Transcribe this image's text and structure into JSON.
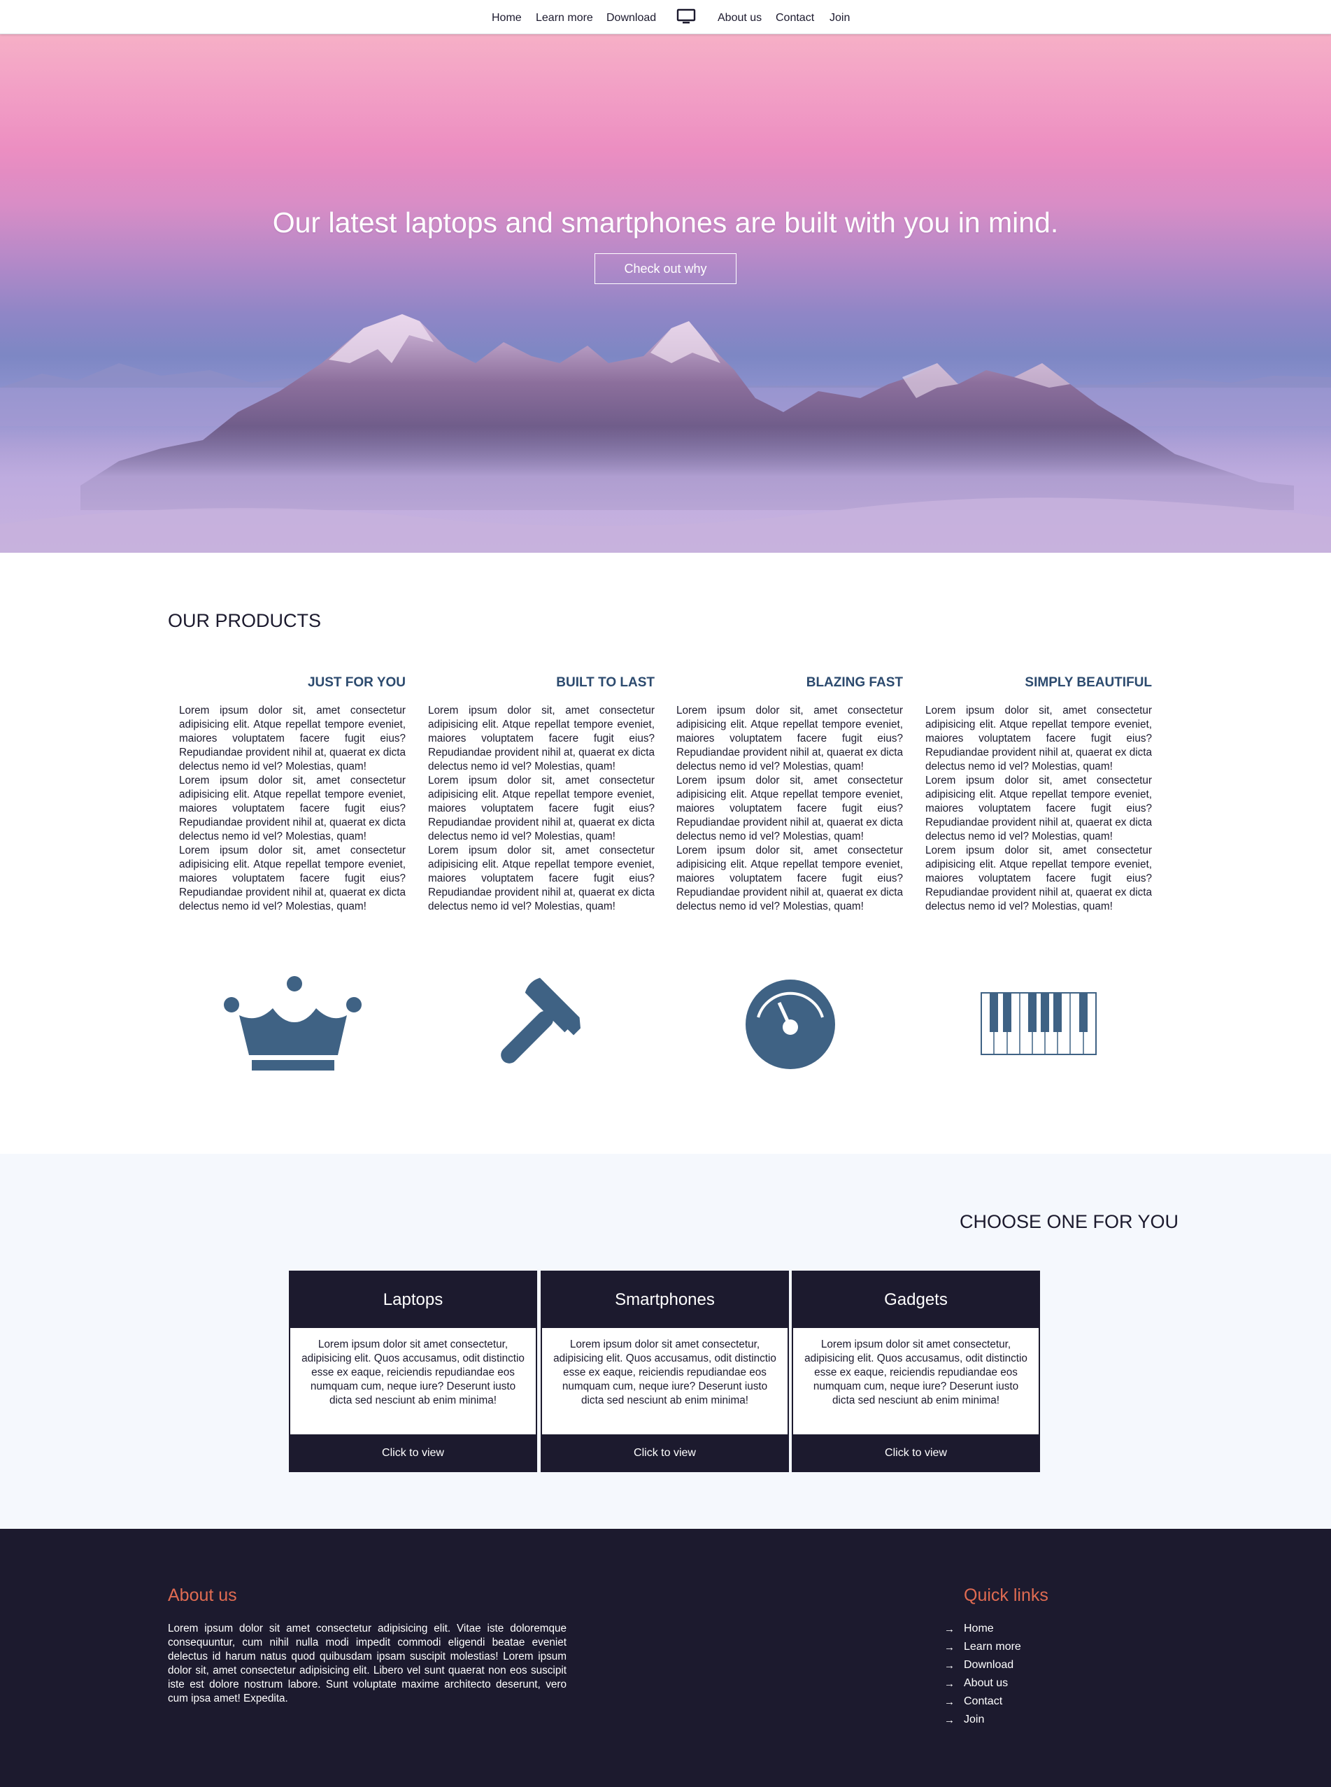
{
  "nav": {
    "items_left": [
      "Home",
      "Learn more",
      "Download"
    ],
    "logo_icon": "monitor-icon",
    "items_right": [
      "About us",
      "Contact",
      "Join"
    ]
  },
  "hero": {
    "title": "Our latest laptops and smartphones are built with you in mind.",
    "button": "Check out why"
  },
  "products": {
    "title": "OUR PRODUCTS",
    "items": [
      {
        "heading": "JUST FOR YOU",
        "paragraphs": [
          "Lorem ipsum dolor sit, amet consectetur adipisicing elit. Atque repellat tempore eveniet, maiores voluptatem facere fugit eius? Repudiandae provident nihil at, quaerat ex dicta delectus nemo id vel? Molestias, quam!",
          "Lorem ipsum dolor sit, amet consectetur adipisicing elit. Atque repellat tempore eveniet, maiores voluptatem facere fugit eius? Repudiandae provident nihil at, quaerat ex dicta delectus nemo id vel? Molestias, quam!",
          "Lorem ipsum dolor sit, amet consectetur adipisicing elit. Atque repellat tempore eveniet, maiores voluptatem facere fugit eius? Repudiandae provident nihil at, quaerat ex dicta delectus nemo id vel? Molestias, quam!"
        ],
        "icon": "crown-icon"
      },
      {
        "heading": "BUILT TO LAST",
        "paragraphs": [
          "Lorem ipsum dolor sit, amet consectetur adipisicing elit. Atque repellat tempore eveniet, maiores voluptatem facere fugit eius? Repudiandae provident nihil at, quaerat ex dicta delectus nemo id vel? Molestias, quam!",
          "Lorem ipsum dolor sit, amet consectetur adipisicing elit. Atque repellat tempore eveniet, maiores voluptatem facere fugit eius? Repudiandae provident nihil at, quaerat ex dicta delectus nemo id vel? Molestias, quam!",
          "Lorem ipsum dolor sit, amet consectetur adipisicing elit. Atque repellat tempore eveniet, maiores voluptatem facere fugit eius? Repudiandae provident nihil at, quaerat ex dicta delectus nemo id vel? Molestias, quam!"
        ],
        "icon": "hammer-icon"
      },
      {
        "heading": "BLAZING FAST",
        "paragraphs": [
          "Lorem ipsum dolor sit, amet consectetur adipisicing elit. Atque repellat tempore eveniet, maiores voluptatem facere fugit eius? Repudiandae provident nihil at, quaerat ex dicta delectus nemo id vel? Molestias, quam!",
          "Lorem ipsum dolor sit, amet consectetur adipisicing elit. Atque repellat tempore eveniet, maiores voluptatem facere fugit eius? Repudiandae provident nihil at, quaerat ex dicta delectus nemo id vel? Molestias, quam!",
          "Lorem ipsum dolor sit, amet consectetur adipisicing elit. Atque repellat tempore eveniet, maiores voluptatem facere fugit eius? Repudiandae provident nihil at, quaerat ex dicta delectus nemo id vel? Molestias, quam!"
        ],
        "icon": "speedometer-icon"
      },
      {
        "heading": "SIMPLY BEAUTIFUL",
        "paragraphs": [
          "Lorem ipsum dolor sit, amet consectetur adipisicing elit. Atque repellat tempore eveniet, maiores voluptatem facere fugit eius? Repudiandae provident nihil at, quaerat ex dicta delectus nemo id vel? Molestias, quam!",
          "Lorem ipsum dolor sit, amet consectetur adipisicing elit. Atque repellat tempore eveniet, maiores voluptatem facere fugit eius? Repudiandae provident nihil at, quaerat ex dicta delectus nemo id vel? Molestias, quam!",
          "Lorem ipsum dolor sit, amet consectetur adipisicing elit. Atque repellat tempore eveniet, maiores voluptatem facere fugit eius? Repudiandae provident nihil at, quaerat ex dicta delectus nemo id vel? Molestias, quam!"
        ],
        "icon": "piano-keys-icon"
      }
    ]
  },
  "choose": {
    "title": "CHOOSE ONE FOR YOU",
    "cards": [
      {
        "title": "Laptops",
        "body": "Lorem ipsum dolor sit amet consectetur, adipisicing elit. Quos accusamus, odit distinctio esse ex eaque, reiciendis repudiandae eos numquam cum, neque iure? Deserunt iusto dicta sed nesciunt ab enim minima!",
        "cta": "Click to view"
      },
      {
        "title": "Smartphones",
        "body": "Lorem ipsum dolor sit amet consectetur, adipisicing elit. Quos accusamus, odit distinctio esse ex eaque, reiciendis repudiandae eos numquam cum, neque iure? Deserunt iusto dicta sed nesciunt ab enim minima!",
        "cta": "Click to view"
      },
      {
        "title": "Gadgets",
        "body": "Lorem ipsum dolor sit amet consectetur, adipisicing elit. Quos accusamus, odit distinctio esse ex eaque, reiciendis repudiandae eos numquam cum, neque iure? Deserunt iusto dicta sed nesciunt ab enim minima!",
        "cta": "Click to view"
      }
    ]
  },
  "footer": {
    "about_title": "About us",
    "about_text": "Lorem ipsum dolor sit amet consectetur adipisicing elit. Vitae iste doloremque consequuntur, cum nihil nulla modi impedit commodi eligendi beatae eveniet delectus id harum natus quod quibusdam ipsam suscipit molestias! Lorem ipsum dolor sit, amet consectetur adipisicing elit. Libero vel sunt quaerat non eos suscipit iste est dolore nostrum labore. Sunt voluptate maxime architecto deserunt, vero cum ipsa amet! Expedita.",
    "links_title": "Quick links",
    "links": [
      "Home",
      "Learn more",
      "Download",
      "About us",
      "Contact",
      "Join"
    ],
    "link_icon": "arrow-right-icon"
  },
  "colors": {
    "dark": "#1c1a2e",
    "accent_blue": "#3f6284",
    "heading_blue": "#2c4a6e",
    "footer_accent": "#e06b52",
    "choose_bg": "#f5f8fd"
  }
}
